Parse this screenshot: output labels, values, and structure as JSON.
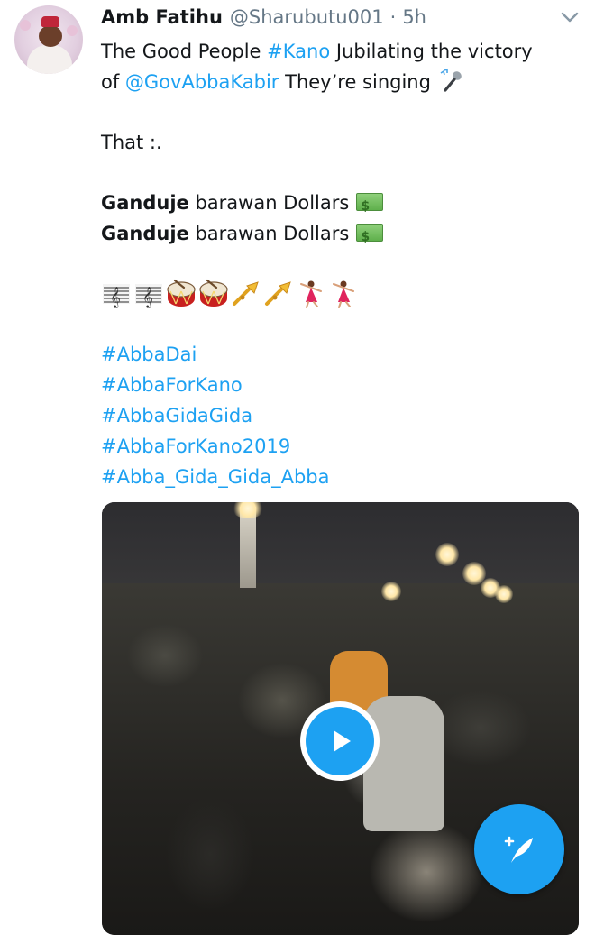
{
  "tweet": {
    "author_name": "Amb Fatihu",
    "handle": "@Sharubutu001",
    "separator": "·",
    "time": "5h",
    "text": {
      "line1_before": "The Good People ",
      "line1_hashtag": "#Kano",
      "line1_after": " Jubilating the victory",
      "line2_before": "of ",
      "line2_mention": "@GovAbbaKabir",
      "line2_after": " They’re singing ",
      "line3": "That :.",
      "chant_bold": "Ganduje",
      "chant_rest": " barawan Dollars",
      "hashtags": [
        "#AbbaDai",
        "#AbbaForKano",
        "#AbbaGidaGida",
        "#AbbaForKano2019",
        "#Abba_Gida_Gida_Abba"
      ]
    },
    "emoji_row": [
      "musical-score",
      "musical-score",
      "drum",
      "drum",
      "trumpet",
      "trumpet",
      "dancer",
      "dancer"
    ]
  },
  "colors": {
    "link": "#1da1f2",
    "text": "#14171a",
    "secondary": "#657786",
    "accent": "#1da1f2"
  },
  "icons": {
    "caret": "chevron-down-icon",
    "play": "play-icon",
    "compose": "compose-tweet-icon"
  }
}
